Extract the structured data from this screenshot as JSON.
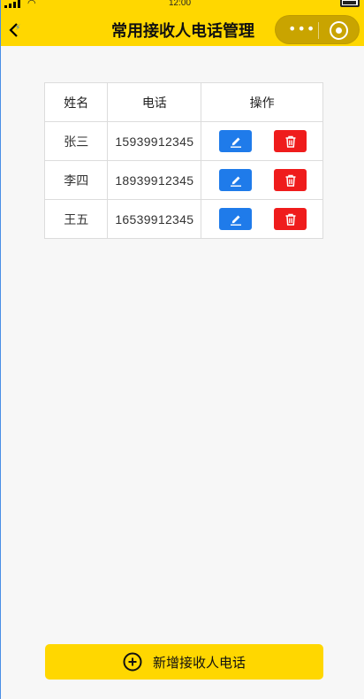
{
  "status_bar": {
    "time": "12:00"
  },
  "header": {
    "title": "常用接收人电话管理"
  },
  "table": {
    "columns": [
      "姓名",
      "电话",
      "操作"
    ],
    "rows": [
      {
        "name": "张三",
        "phone": "15939912345"
      },
      {
        "name": "李四",
        "phone": "18939912345"
      },
      {
        "name": "王五",
        "phone": "16539912345"
      }
    ]
  },
  "add_button": {
    "label": "新增接收人电话",
    "icon": "plus-circle-icon"
  },
  "colors": {
    "accent": "#ffd700",
    "edit": "#1f7bea",
    "delete": "#ef1c1c"
  }
}
